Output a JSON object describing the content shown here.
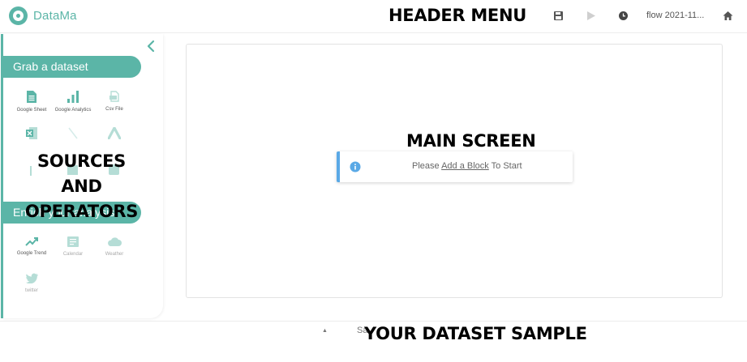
{
  "header": {
    "logo_text": "DataMa",
    "flow_name": "flow 2021-11...",
    "icons": [
      "save-icon",
      "play-icon",
      "clock-icon",
      "home-icon"
    ]
  },
  "annotations": {
    "header_menu": "HEADER MENU",
    "main_screen": "MAIN SCREEN",
    "sources_operators": "SOURCES AND OPERATORS",
    "dataset_sample": "YOUR DATASET SAMPLE"
  },
  "sidebar": {
    "grab_title": "Grab a dataset",
    "grab_items": [
      {
        "label": "Google Sheet",
        "icon": "google-sheet-icon"
      },
      {
        "label": "Google Analytics",
        "icon": "google-analytics-icon"
      },
      {
        "label": "Csv File",
        "icon": "csv-file-icon"
      },
      {
        "label": "",
        "icon": "excel-icon"
      },
      {
        "label": "",
        "icon": "pen-icon"
      },
      {
        "label": "",
        "icon": "google-ads-icon"
      }
    ],
    "enrich_title": "Enrich your analysis",
    "enrich_items": [
      {
        "label": "Google Trend",
        "icon": "trend-icon"
      },
      {
        "label": "Calendar",
        "icon": "calendar-icon"
      },
      {
        "label": "Weather",
        "icon": "cloud-icon"
      },
      {
        "label": "twitter",
        "icon": "twitter-icon"
      }
    ]
  },
  "main": {
    "notice_prefix": "Please ",
    "notice_link": "Add a Block",
    "notice_suffix": " To Start"
  },
  "bottom": {
    "tab_label": "Sa"
  },
  "colors": {
    "accent": "#5bb5a7",
    "info": "#5aa9e6"
  }
}
